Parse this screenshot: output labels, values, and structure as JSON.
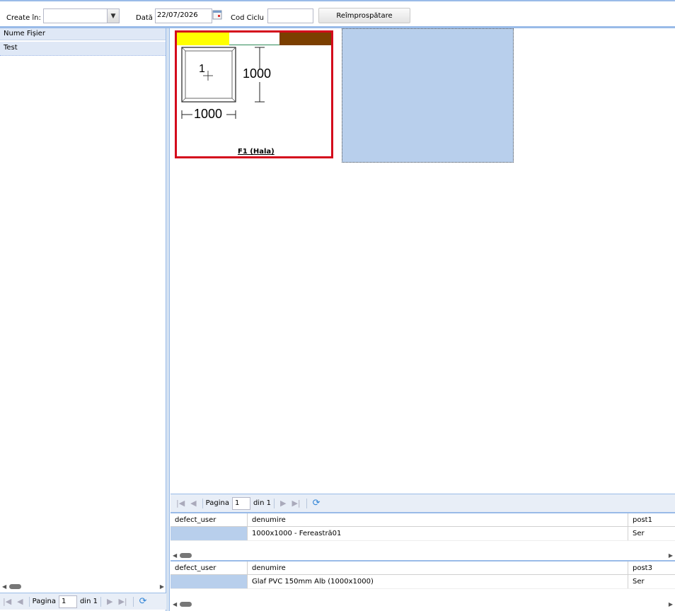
{
  "toolbar": {
    "created_in_label": "Create în:",
    "created_in_value": "",
    "date_label": "Dată",
    "date_value": "22/07/2026",
    "cycle_label": "Cod Ciclu",
    "cycle_value": "",
    "refresh_button": "Reîmprospătare"
  },
  "file_list": {
    "header": "Nume Fișier",
    "rows": [
      "Test"
    ]
  },
  "left_pager": {
    "page_label": "Pagina",
    "page_value": "1",
    "of_label": "din 1"
  },
  "tile": {
    "width_dim": "1000",
    "height_dim": "1000",
    "pane_number": "1",
    "caption": "F1 (Hala)",
    "colors": {
      "yellow": "#ffff00",
      "brown": "#7b3f00",
      "frame": "#d4091c"
    }
  },
  "right_pager": {
    "page_label": "Pagina",
    "page_value": "1",
    "of_label": "din 1"
  },
  "grid1": {
    "headers": [
      "defect_user",
      "denumire",
      "post1"
    ],
    "rows": [
      [
        "",
        "1000x1000 - Fereastră01",
        "Ser"
      ]
    ]
  },
  "grid2": {
    "headers": [
      "defect_user",
      "denumire",
      "post3"
    ],
    "rows": [
      [
        "",
        "Glaf PVC 150mm Alb (1000x1000)",
        "Ser"
      ]
    ]
  }
}
